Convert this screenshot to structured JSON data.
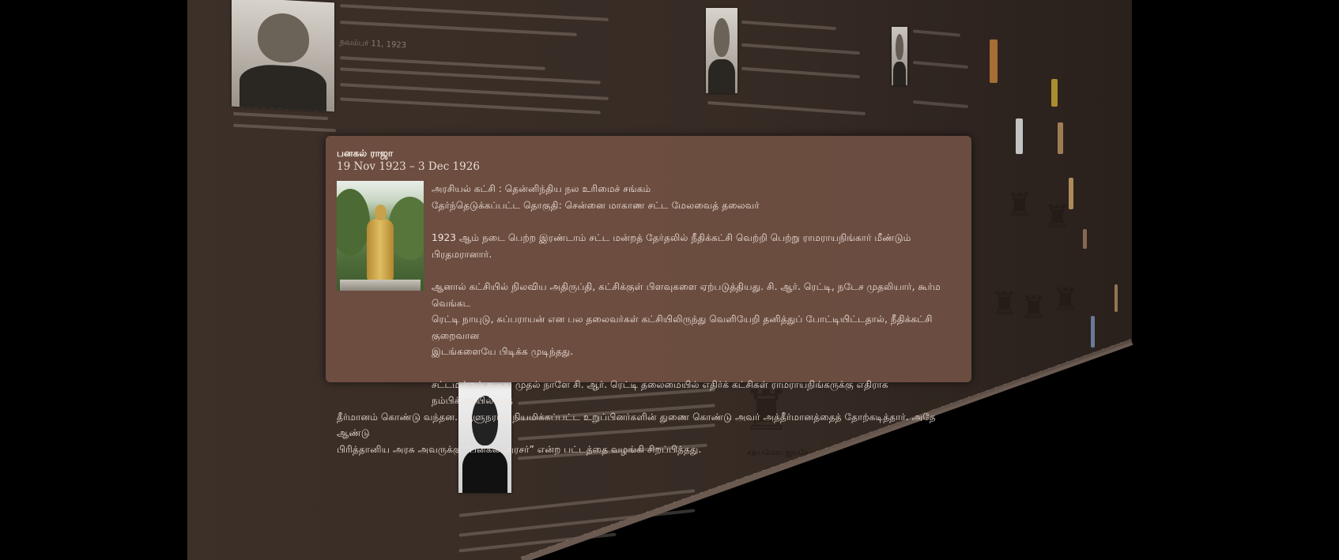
{
  "popup": {
    "title": "பனகல் ராஜா",
    "dates": "19 Nov 1923 – 3 Dec 1926",
    "party_line": "அரசியல் கட்சி : தென்னிந்திய நல உரிமைச் சங்கம்",
    "constituency_line": "தேர்ந்தெடுக்கப்பட்ட தொகுதி: சென்னை மாகாண சட்ட மேலவைத் தலைவர்",
    "paragraph_1": "1923 ஆம் நடை பெற்ற இரண்டாம் சட்ட மன்றத் தேர்தலில் நீதிக்கட்சி வெற்றி பெற்று ராமராயநிங்கார் மீண்டும் பிரதமரானார்.",
    "paragraph_2_line_1": "ஆனால் கட்சியில் நிலவிய அதிருப்தி, கட்சிக்குள் பிளவுகளை ஏற்படுத்தியது. சி. ஆர். ரெட்டி, நடேச முதலியார், கூர்ம வெங்கட",
    "paragraph_2_line_2": "ரெட்டி நாயுடு, சுப்பராயன் என பல தலைவர்கள் கட்சியிலிருந்து வெளியேறி தனித்துப் போட்டியிட்டதால், நீதிக்கட்சி குறைவான",
    "paragraph_2_line_3": "இடங்களையே பிடிக்க முடிந்தது.",
    "paragraph_3_line_1": "சட்டமன்றம் கூடிய முதல் நாளே சி. ஆர். ரெட்டி தலைமையில் எதிர்க் கட்சிகள் ராமராயநிங்கருக்கு எதிராக நம்பிக்கையில்லாத்",
    "paragraph_3_line_2": "தீர்மானம் கொண்டு வந்தன. ஆளுநரால் நியமிக்கப்பட்ட உறுப்பினர்களின் துணை கொண்டு அவர் அத்தீர்மானத்தைத் தோற்கடித்தார். அதே ஆண்டு",
    "paragraph_3_line_3": "பிரித்தானிய அரசு அவருக்கு “பனகல் அரசர்” என்ற பட்டத்தை வழங்கி சிறப்பித்தது."
  },
  "background": {
    "date_1": "நவம்பர் 11, 1923",
    "emblem_caption": "சத்யமேவ ஜயதே"
  },
  "colors": {
    "page_bg": "#000000",
    "wall": "#3a2e27",
    "popup_bg": "#735244",
    "popup_text": "#efe3dc"
  },
  "icons": {
    "statue_photo": "statue-photo",
    "portrait": "portrait-photo",
    "emblem": "emblem-icon"
  }
}
